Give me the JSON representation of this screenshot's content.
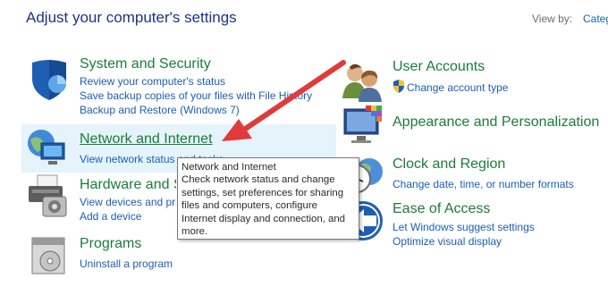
{
  "header": {
    "title": "Adjust your computer's settings",
    "view_by_label": "View by:",
    "view_by_value": "Categ"
  },
  "categories": {
    "system_security": {
      "title": "System and Security",
      "links": [
        "Review your computer's status",
        "Save backup copies of your files with File History",
        "Backup and Restore (Windows 7)"
      ]
    },
    "network": {
      "title": "Network and Internet",
      "links": [
        "View network status and tasks"
      ]
    },
    "hardware": {
      "title": "Hardware and Sound",
      "links": [
        "View devices and printers",
        "Add a device"
      ]
    },
    "programs": {
      "title": "Programs",
      "links": [
        "Uninstall a program"
      ]
    },
    "user_accounts": {
      "title": "User Accounts",
      "links": [
        "Change account type"
      ]
    },
    "appearance": {
      "title": "Appearance and Personalization"
    },
    "clock": {
      "title": "Clock and Region",
      "links": [
        "Change date, time, or number formats"
      ]
    },
    "ease": {
      "title": "Ease of Access",
      "links": [
        "Let Windows suggest settings",
        "Optimize visual display"
      ]
    }
  },
  "tooltip": {
    "lines": [
      "Network and Internet",
      "Check network status and change",
      "settings, set preferences for sharing",
      "files and computers, configure",
      "Internet display and connection, and",
      "more."
    ]
  },
  "colors": {
    "category_title": "#1c7b3b",
    "link": "#1a5fb4",
    "hover_background": "#e5f3fb",
    "arrow": "#e03a3a"
  },
  "icons": {
    "system_security": "shield-icon",
    "network": "network-globe-icon",
    "hardware": "printer-icon",
    "programs": "programs-disc-icon",
    "user_accounts": "users-icon",
    "appearance": "monitor-palette-icon",
    "clock": "clock-globe-icon",
    "ease": "ease-of-access-icon"
  }
}
